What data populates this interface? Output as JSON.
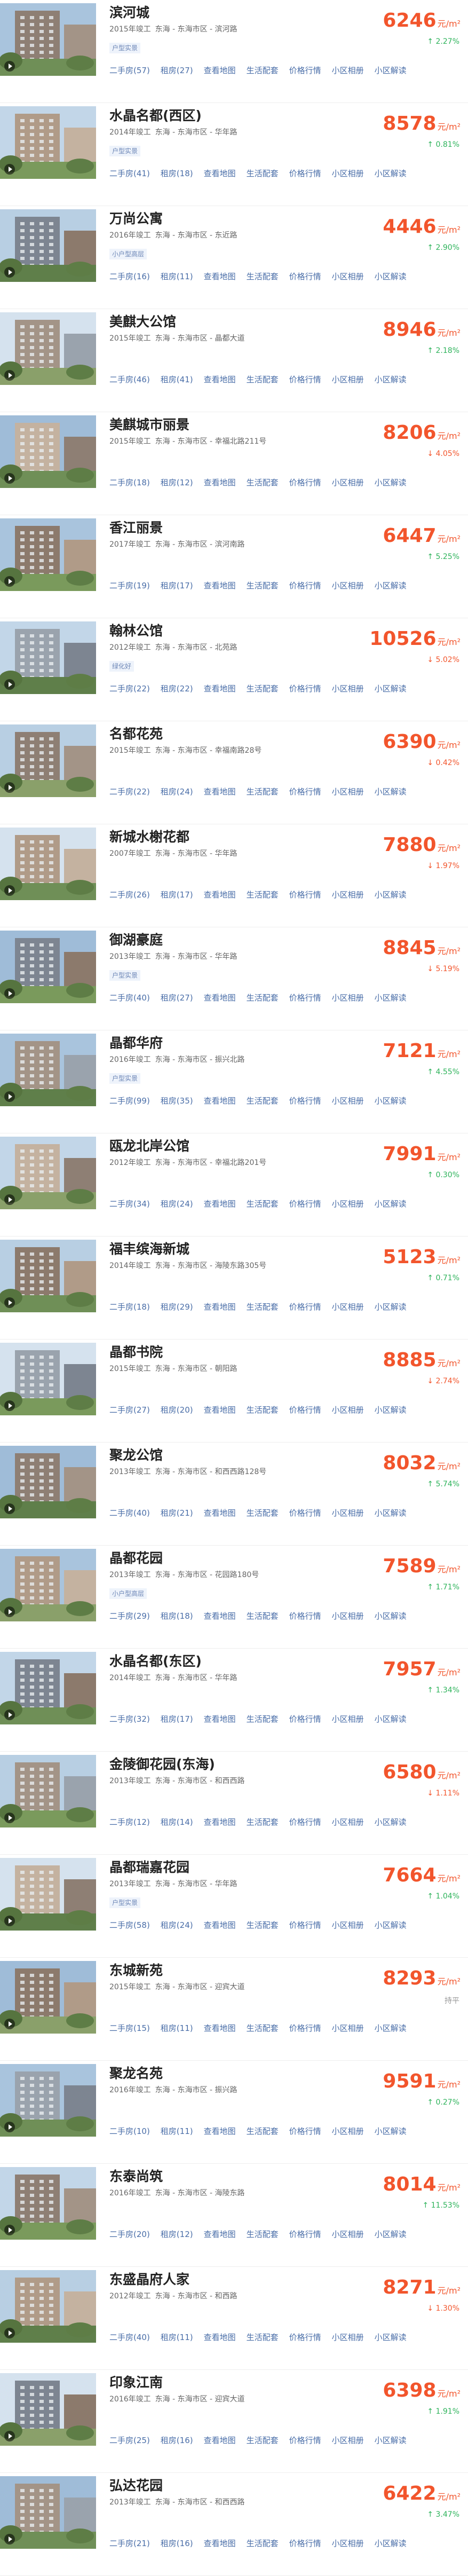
{
  "labels": {
    "links": [
      "二手房",
      "租房",
      "查看地图",
      "生活配套",
      "价格行情",
      "小区相册",
      "小区解读"
    ],
    "unit": "元/m²"
  },
  "palette": {
    "price": "#f2552c",
    "rise": "#2eb35b",
    "flat": "#999999",
    "link": "#4a6ea8",
    "tag_text": "#6d87b7",
    "tag_bg": "#eef3fb"
  },
  "communities": [
    {
      "name": "滨河城",
      "year": "2015年竣工",
      "location": "东海 - 东海市区 - 滨河路",
      "tag": "户型实景",
      "ershou": "二手房(57)",
      "rent": "租房(27)",
      "price": "6246",
      "change": "↑ 2.27%",
      "trend": "up"
    },
    {
      "name": "水晶名都(西区)",
      "year": "2014年竣工",
      "location": "东海 - 东海市区 - 华年路",
      "tag": "户型实景",
      "ershou": "二手房(41)",
      "rent": "租房(18)",
      "price": "8578",
      "change": "↑ 0.81%",
      "trend": "up"
    },
    {
      "name": "万尚公寓",
      "year": "2016年竣工",
      "location": "东海 - 东海市区 - 东近路",
      "tag": "小户型高层",
      "ershou": "二手房(16)",
      "rent": "租房(11)",
      "price": "4446",
      "change": "↑ 2.90%",
      "trend": "up"
    },
    {
      "name": "美麒大公馆",
      "year": "2015年竣工",
      "location": "东海 - 东海市区 - 晶都大道",
      "tag": "",
      "ershou": "二手房(46)",
      "rent": "租房(41)",
      "price": "8946",
      "change": "↑ 2.18%",
      "trend": "up"
    },
    {
      "name": "美麒城市丽景",
      "year": "2015年竣工",
      "location": "东海 - 东海市区 - 幸福北路211号",
      "tag": "",
      "ershou": "二手房(18)",
      "rent": "租房(12)",
      "price": "8206",
      "change": "↓ 4.05%",
      "trend": "down"
    },
    {
      "name": "香江丽景",
      "year": "2017年竣工",
      "location": "东海 - 东海市区 - 滨河南路",
      "tag": "",
      "ershou": "二手房(19)",
      "rent": "租房(17)",
      "price": "6447",
      "change": "↑ 5.25%",
      "trend": "up"
    },
    {
      "name": "翰林公馆",
      "year": "2012年竣工",
      "location": "东海 - 东海市区 - 北苑路",
      "tag": "绿化好",
      "ershou": "二手房(22)",
      "rent": "租房(22)",
      "price": "10526",
      "change": "↓ 5.02%",
      "trend": "down"
    },
    {
      "name": "名都花苑",
      "year": "2015年竣工",
      "location": "东海 - 东海市区 - 幸福南路28号",
      "tag": "",
      "ershou": "二手房(22)",
      "rent": "租房(24)",
      "price": "6390",
      "change": "↓ 0.42%",
      "trend": "down"
    },
    {
      "name": "新城水榭花都",
      "year": "2007年竣工",
      "location": "东海 - 东海市区 - 华年路",
      "tag": "",
      "ershou": "二手房(26)",
      "rent": "租房(17)",
      "price": "7880",
      "change": "↓ 1.97%",
      "trend": "down"
    },
    {
      "name": "御湖豪庭",
      "year": "2013年竣工",
      "location": "东海 - 东海市区 - 华年路",
      "tag": "户型实景",
      "ershou": "二手房(40)",
      "rent": "租房(27)",
      "price": "8845",
      "change": "↓ 5.19%",
      "trend": "down"
    },
    {
      "name": "晶都华府",
      "year": "2016年竣工",
      "location": "东海 - 东海市区 - 振兴北路",
      "tag": "户型实景",
      "ershou": "二手房(99)",
      "rent": "租房(35)",
      "price": "7121",
      "change": "↑ 4.55%",
      "trend": "up"
    },
    {
      "name": "瓯龙北岸公馆",
      "year": "2012年竣工",
      "location": "东海 - 东海市区 - 幸福北路201号",
      "tag": "",
      "ershou": "二手房(34)",
      "rent": "租房(24)",
      "price": "7991",
      "change": "↑ 0.30%",
      "trend": "up"
    },
    {
      "name": "福丰缤海新城",
      "year": "2014年竣工",
      "location": "东海 - 东海市区 - 海陵东路305号",
      "tag": "",
      "ershou": "二手房(18)",
      "rent": "租房(29)",
      "price": "5123",
      "change": "↑ 0.71%",
      "trend": "up"
    },
    {
      "name": "晶都书院",
      "year": "2015年竣工",
      "location": "东海 - 东海市区 - 朝阳路",
      "tag": "",
      "ershou": "二手房(27)",
      "rent": "租房(20)",
      "price": "8885",
      "change": "↓ 2.74%",
      "trend": "down"
    },
    {
      "name": "聚龙公馆",
      "year": "2013年竣工",
      "location": "东海 - 东海市区 - 和西西路128号",
      "tag": "",
      "ershou": "二手房(40)",
      "rent": "租房(21)",
      "price": "8032",
      "change": "↑ 5.74%",
      "trend": "up"
    },
    {
      "name": "晶都花园",
      "year": "2013年竣工",
      "location": "东海 - 东海市区 - 花园路180号",
      "tag": "小户型高层",
      "ershou": "二手房(29)",
      "rent": "租房(18)",
      "price": "7589",
      "change": "↑ 1.71%",
      "trend": "up"
    },
    {
      "name": "水晶名都(东区)",
      "year": "2014年竣工",
      "location": "东海 - 东海市区 - 华年路",
      "tag": "",
      "ershou": "二手房(32)",
      "rent": "租房(17)",
      "price": "7957",
      "change": "↑ 1.34%",
      "trend": "up"
    },
    {
      "name": "金陵御花园(东海)",
      "year": "2013年竣工",
      "location": "东海 - 东海市区 - 和西西路",
      "tag": "",
      "ershou": "二手房(12)",
      "rent": "租房(14)",
      "price": "6580",
      "change": "↓ 1.11%",
      "trend": "down"
    },
    {
      "name": "晶都瑞嘉花园",
      "year": "2013年竣工",
      "location": "东海 - 东海市区 - 华年路",
      "tag": "户型实景",
      "ershou": "二手房(58)",
      "rent": "租房(24)",
      "price": "7664",
      "change": "↑ 1.04%",
      "trend": "up"
    },
    {
      "name": "东城新苑",
      "year": "2015年竣工",
      "location": "东海 - 东海市区 - 迎宾大道",
      "tag": "",
      "ershou": "二手房(15)",
      "rent": "租房(11)",
      "price": "8293",
      "change": "持平",
      "trend": "flat"
    },
    {
      "name": "聚龙名苑",
      "year": "2016年竣工",
      "location": "东海 - 东海市区 - 振兴路",
      "tag": "",
      "ershou": "二手房(10)",
      "rent": "租房(11)",
      "price": "9591",
      "change": "↑ 0.27%",
      "trend": "up"
    },
    {
      "name": "东泰尚筑",
      "year": "2016年竣工",
      "location": "东海 - 东海市区 - 海陵东路",
      "tag": "",
      "ershou": "二手房(20)",
      "rent": "租房(12)",
      "price": "8014",
      "change": "↑ 11.53%",
      "trend": "up"
    },
    {
      "name": "东盛晶府人家",
      "year": "2012年竣工",
      "location": "东海 - 东海市区 - 和西路",
      "tag": "",
      "ershou": "二手房(40)",
      "rent": "租房(11)",
      "price": "8271",
      "change": "↓ 1.30%",
      "trend": "down"
    },
    {
      "name": "印象江南",
      "year": "2016年竣工",
      "location": "东海 - 东海市区 - 迎宾大道",
      "tag": "",
      "ershou": "二手房(25)",
      "rent": "租房(16)",
      "price": "6398",
      "change": "↑ 1.91%",
      "trend": "up"
    },
    {
      "name": "弘达花园",
      "year": "2013年竣工",
      "location": "东海 - 东海市区 - 和西西路",
      "tag": "",
      "ershou": "二手房(21)",
      "rent": "租房(16)",
      "price": "6422",
      "change": "↑ 3.47%",
      "trend": "up"
    }
  ]
}
